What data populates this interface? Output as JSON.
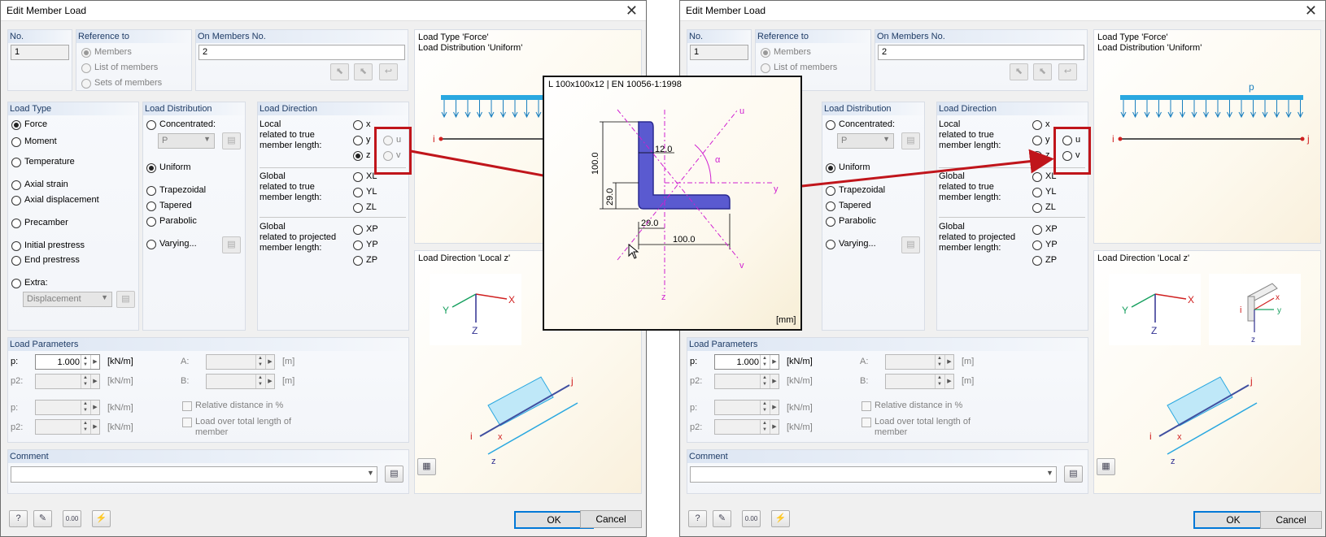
{
  "dialog": {
    "title": "Edit Member Load",
    "close_glyph": "✕"
  },
  "no": {
    "header": "No.",
    "value": "1"
  },
  "reference": {
    "header": "Reference to",
    "options": [
      "Members",
      "List of members",
      "Sets of members"
    ],
    "selected": "Members"
  },
  "on_members": {
    "header": "On Members No.",
    "value": "2"
  },
  "load_type": {
    "header": "Load Type",
    "options": [
      "Force",
      "Moment",
      "Temperature",
      "Axial strain",
      "Axial displacement",
      "Precamber",
      "Initial prestress",
      "End prestress",
      "Extra:"
    ],
    "selected": "Force",
    "extra_combo": "Displacement"
  },
  "load_distribution": {
    "header": "Load Distribution",
    "options": [
      "Concentrated:",
      "Uniform",
      "Trapezoidal",
      "Tapered",
      "Parabolic",
      "Varying..."
    ],
    "selected": "Uniform",
    "concentrated_combo": "P"
  },
  "load_direction": {
    "header": "Load Direction",
    "local_label": "Local\nrelated to true\nmember length:",
    "local_options": [
      "x",
      "y",
      "z"
    ],
    "local_selected": "z",
    "extra_options": [
      "u",
      "v"
    ],
    "global_true_label": "Global\nrelated to true\nmember length:",
    "global_true_options": [
      "XL",
      "YL",
      "ZL"
    ],
    "global_proj_label": "Global\nrelated to projected\nmember length:",
    "global_proj_options": [
      "XP",
      "YP",
      "ZP"
    ]
  },
  "preview_top": {
    "line1": "Load Type 'Force'",
    "line2": "Load Distribution 'Uniform'",
    "load_symbol": "p",
    "node_i": "i",
    "node_j": "j"
  },
  "preview_bottom": {
    "title": "Load Direction 'Local z'",
    "axis_x": "X",
    "axis_y": "Y",
    "axis_z": "Z",
    "local_x": "x",
    "local_y": "y",
    "local_z": "z",
    "node_i": "i",
    "node_j": "j"
  },
  "load_parameters": {
    "header": "Load Parameters",
    "p_label": "p:",
    "p_value": "1.000",
    "p_unit": "[kN/m]",
    "p2_label": "p2:",
    "p2_unit": "[kN/m]",
    "p_b_label": "p:",
    "p_b_unit": "[kN/m]",
    "p2_b_label": "p2:",
    "p2_b_unit": "[kN/m]",
    "a_label": "A:",
    "a_unit": "[m]",
    "b_label": "B:",
    "b_unit": "[m]",
    "relative_label": "Relative distance in %",
    "load_over_label": "Load over total length of",
    "load_over_label2": "member"
  },
  "comment": {
    "header": "Comment",
    "value": ""
  },
  "buttons": {
    "ok": "OK",
    "cancel": "Cancel"
  },
  "section_popup": {
    "title": "L 100x100x12 | EN 10056-1:1998",
    "dim_100_v": "100.0",
    "dim_12": "12.0",
    "dim_29_v": "29.0",
    "dim_29_h": "29.0",
    "dim_100_h": "100.0",
    "axis_u": "u",
    "axis_v": "v",
    "axis_y": "y",
    "axis_z": "z",
    "alpha": "α",
    "unit": "[mm]"
  },
  "colors": {
    "highlight": "#c0151b",
    "load_blue": "#2aa8e0",
    "section_fill": "#5a5ad0",
    "axis_magenta": "#d020d0",
    "group_header_text": "#1f3c66"
  }
}
